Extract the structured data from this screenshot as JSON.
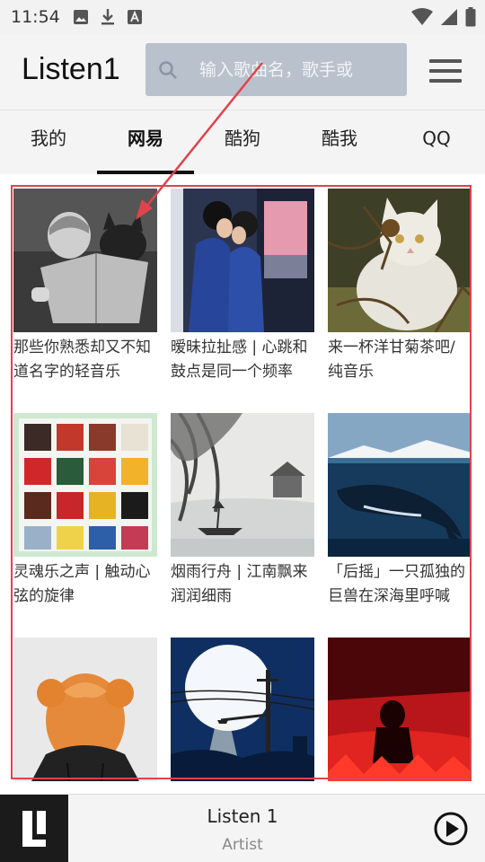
{
  "status_bar": {
    "time": "11:54",
    "icons": [
      "image-icon",
      "download-icon",
      "font-icon",
      "wifi-icon",
      "signal-icon",
      "battery-icon"
    ]
  },
  "app": {
    "title": "Listen1",
    "search_placeholder": "输入歌曲名，歌手或",
    "menu_icon": "hamburger-menu-icon"
  },
  "tabs": [
    {
      "label": "我的",
      "active": false
    },
    {
      "label": "网易",
      "active": true
    },
    {
      "label": "酷狗",
      "active": false
    },
    {
      "label": "酷我",
      "active": false
    },
    {
      "label": "QQ",
      "active": false
    }
  ],
  "playlists": [
    {
      "title": "那些你熟悉却又不知道名字的轻音乐"
    },
    {
      "title": "暧昧拉扯感 | 心跳和鼓点是同一个频率"
    },
    {
      "title": "来一杯洋甘菊茶吧/纯音乐"
    },
    {
      "title": "灵魂乐之声 | 触动心弦的旋律"
    },
    {
      "title": "烟雨行舟 | 江南飘来润润细雨"
    },
    {
      "title": "「后摇」一只孤独的巨兽在深海里呼喊"
    },
    {
      "title": ""
    },
    {
      "title": ""
    },
    {
      "title": ""
    }
  ],
  "player": {
    "title": "Listen 1",
    "artist": "Artist",
    "logo_icon": "listen1-logo-icon",
    "play_icon": "play-circle-icon"
  },
  "colors": {
    "annotation": "#e0434b",
    "search_bg": "#b9c1cc",
    "bar_bg": "#f4f4f4"
  }
}
